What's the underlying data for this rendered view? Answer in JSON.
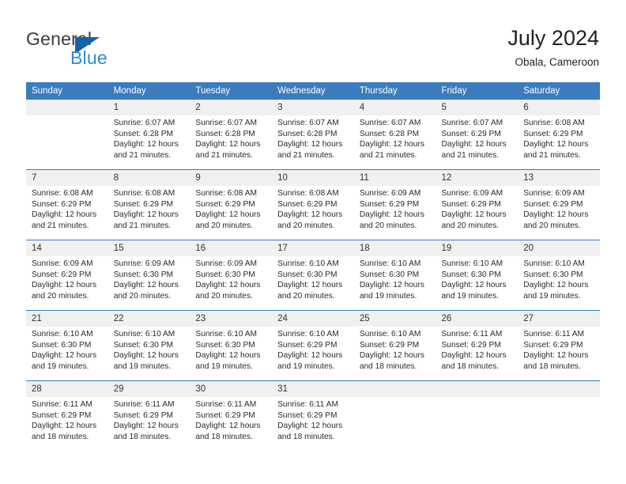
{
  "brand": {
    "name_top": "General",
    "name_bottom": "Blue",
    "triangle_color": "#1161ab",
    "blue_color": "#2e8ad6"
  },
  "header": {
    "title": "July 2024",
    "subtitle": "Obala, Cameroon"
  },
  "theme": {
    "header_blue": "#3a7cbe",
    "daynum_band": "#f0f0f0",
    "text": "#222222"
  },
  "calendar": {
    "weekday_headers": [
      "Sunday",
      "Monday",
      "Tuesday",
      "Wednesday",
      "Thursday",
      "Friday",
      "Saturday"
    ],
    "weeks": [
      [
        {
          "day": "",
          "sunrise": "",
          "sunset": "",
          "daylight_1": "",
          "daylight_2": "",
          "empty": true
        },
        {
          "day": "1",
          "sunrise": "Sunrise: 6:07 AM",
          "sunset": "Sunset: 6:28 PM",
          "daylight_1": "Daylight: 12 hours",
          "daylight_2": "and 21 minutes."
        },
        {
          "day": "2",
          "sunrise": "Sunrise: 6:07 AM",
          "sunset": "Sunset: 6:28 PM",
          "daylight_1": "Daylight: 12 hours",
          "daylight_2": "and 21 minutes."
        },
        {
          "day": "3",
          "sunrise": "Sunrise: 6:07 AM",
          "sunset": "Sunset: 6:28 PM",
          "daylight_1": "Daylight: 12 hours",
          "daylight_2": "and 21 minutes."
        },
        {
          "day": "4",
          "sunrise": "Sunrise: 6:07 AM",
          "sunset": "Sunset: 6:28 PM",
          "daylight_1": "Daylight: 12 hours",
          "daylight_2": "and 21 minutes."
        },
        {
          "day": "5",
          "sunrise": "Sunrise: 6:07 AM",
          "sunset": "Sunset: 6:29 PM",
          "daylight_1": "Daylight: 12 hours",
          "daylight_2": "and 21 minutes."
        },
        {
          "day": "6",
          "sunrise": "Sunrise: 6:08 AM",
          "sunset": "Sunset: 6:29 PM",
          "daylight_1": "Daylight: 12 hours",
          "daylight_2": "and 21 minutes."
        }
      ],
      [
        {
          "day": "7",
          "sunrise": "Sunrise: 6:08 AM",
          "sunset": "Sunset: 6:29 PM",
          "daylight_1": "Daylight: 12 hours",
          "daylight_2": "and 21 minutes."
        },
        {
          "day": "8",
          "sunrise": "Sunrise: 6:08 AM",
          "sunset": "Sunset: 6:29 PM",
          "daylight_1": "Daylight: 12 hours",
          "daylight_2": "and 21 minutes."
        },
        {
          "day": "9",
          "sunrise": "Sunrise: 6:08 AM",
          "sunset": "Sunset: 6:29 PM",
          "daylight_1": "Daylight: 12 hours",
          "daylight_2": "and 20 minutes."
        },
        {
          "day": "10",
          "sunrise": "Sunrise: 6:08 AM",
          "sunset": "Sunset: 6:29 PM",
          "daylight_1": "Daylight: 12 hours",
          "daylight_2": "and 20 minutes."
        },
        {
          "day": "11",
          "sunrise": "Sunrise: 6:09 AM",
          "sunset": "Sunset: 6:29 PM",
          "daylight_1": "Daylight: 12 hours",
          "daylight_2": "and 20 minutes."
        },
        {
          "day": "12",
          "sunrise": "Sunrise: 6:09 AM",
          "sunset": "Sunset: 6:29 PM",
          "daylight_1": "Daylight: 12 hours",
          "daylight_2": "and 20 minutes."
        },
        {
          "day": "13",
          "sunrise": "Sunrise: 6:09 AM",
          "sunset": "Sunset: 6:29 PM",
          "daylight_1": "Daylight: 12 hours",
          "daylight_2": "and 20 minutes."
        }
      ],
      [
        {
          "day": "14",
          "sunrise": "Sunrise: 6:09 AM",
          "sunset": "Sunset: 6:29 PM",
          "daylight_1": "Daylight: 12 hours",
          "daylight_2": "and 20 minutes."
        },
        {
          "day": "15",
          "sunrise": "Sunrise: 6:09 AM",
          "sunset": "Sunset: 6:30 PM",
          "daylight_1": "Daylight: 12 hours",
          "daylight_2": "and 20 minutes."
        },
        {
          "day": "16",
          "sunrise": "Sunrise: 6:09 AM",
          "sunset": "Sunset: 6:30 PM",
          "daylight_1": "Daylight: 12 hours",
          "daylight_2": "and 20 minutes."
        },
        {
          "day": "17",
          "sunrise": "Sunrise: 6:10 AM",
          "sunset": "Sunset: 6:30 PM",
          "daylight_1": "Daylight: 12 hours",
          "daylight_2": "and 20 minutes."
        },
        {
          "day": "18",
          "sunrise": "Sunrise: 6:10 AM",
          "sunset": "Sunset: 6:30 PM",
          "daylight_1": "Daylight: 12 hours",
          "daylight_2": "and 19 minutes."
        },
        {
          "day": "19",
          "sunrise": "Sunrise: 6:10 AM",
          "sunset": "Sunset: 6:30 PM",
          "daylight_1": "Daylight: 12 hours",
          "daylight_2": "and 19 minutes."
        },
        {
          "day": "20",
          "sunrise": "Sunrise: 6:10 AM",
          "sunset": "Sunset: 6:30 PM",
          "daylight_1": "Daylight: 12 hours",
          "daylight_2": "and 19 minutes."
        }
      ],
      [
        {
          "day": "21",
          "sunrise": "Sunrise: 6:10 AM",
          "sunset": "Sunset: 6:30 PM",
          "daylight_1": "Daylight: 12 hours",
          "daylight_2": "and 19 minutes."
        },
        {
          "day": "22",
          "sunrise": "Sunrise: 6:10 AM",
          "sunset": "Sunset: 6:30 PM",
          "daylight_1": "Daylight: 12 hours",
          "daylight_2": "and 19 minutes."
        },
        {
          "day": "23",
          "sunrise": "Sunrise: 6:10 AM",
          "sunset": "Sunset: 6:30 PM",
          "daylight_1": "Daylight: 12 hours",
          "daylight_2": "and 19 minutes."
        },
        {
          "day": "24",
          "sunrise": "Sunrise: 6:10 AM",
          "sunset": "Sunset: 6:29 PM",
          "daylight_1": "Daylight: 12 hours",
          "daylight_2": "and 19 minutes."
        },
        {
          "day": "25",
          "sunrise": "Sunrise: 6:10 AM",
          "sunset": "Sunset: 6:29 PM",
          "daylight_1": "Daylight: 12 hours",
          "daylight_2": "and 18 minutes."
        },
        {
          "day": "26",
          "sunrise": "Sunrise: 6:11 AM",
          "sunset": "Sunset: 6:29 PM",
          "daylight_1": "Daylight: 12 hours",
          "daylight_2": "and 18 minutes."
        },
        {
          "day": "27",
          "sunrise": "Sunrise: 6:11 AM",
          "sunset": "Sunset: 6:29 PM",
          "daylight_1": "Daylight: 12 hours",
          "daylight_2": "and 18 minutes."
        }
      ],
      [
        {
          "day": "28",
          "sunrise": "Sunrise: 6:11 AM",
          "sunset": "Sunset: 6:29 PM",
          "daylight_1": "Daylight: 12 hours",
          "daylight_2": "and 18 minutes."
        },
        {
          "day": "29",
          "sunrise": "Sunrise: 6:11 AM",
          "sunset": "Sunset: 6:29 PM",
          "daylight_1": "Daylight: 12 hours",
          "daylight_2": "and 18 minutes."
        },
        {
          "day": "30",
          "sunrise": "Sunrise: 6:11 AM",
          "sunset": "Sunset: 6:29 PM",
          "daylight_1": "Daylight: 12 hours",
          "daylight_2": "and 18 minutes."
        },
        {
          "day": "31",
          "sunrise": "Sunrise: 6:11 AM",
          "sunset": "Sunset: 6:29 PM",
          "daylight_1": "Daylight: 12 hours",
          "daylight_2": "and 18 minutes."
        },
        {
          "day": "",
          "sunrise": "",
          "sunset": "",
          "daylight_1": "",
          "daylight_2": "",
          "empty": true
        },
        {
          "day": "",
          "sunrise": "",
          "sunset": "",
          "daylight_1": "",
          "daylight_2": "",
          "empty": true
        },
        {
          "day": "",
          "sunrise": "",
          "sunset": "",
          "daylight_1": "",
          "daylight_2": "",
          "empty": true
        }
      ]
    ]
  }
}
